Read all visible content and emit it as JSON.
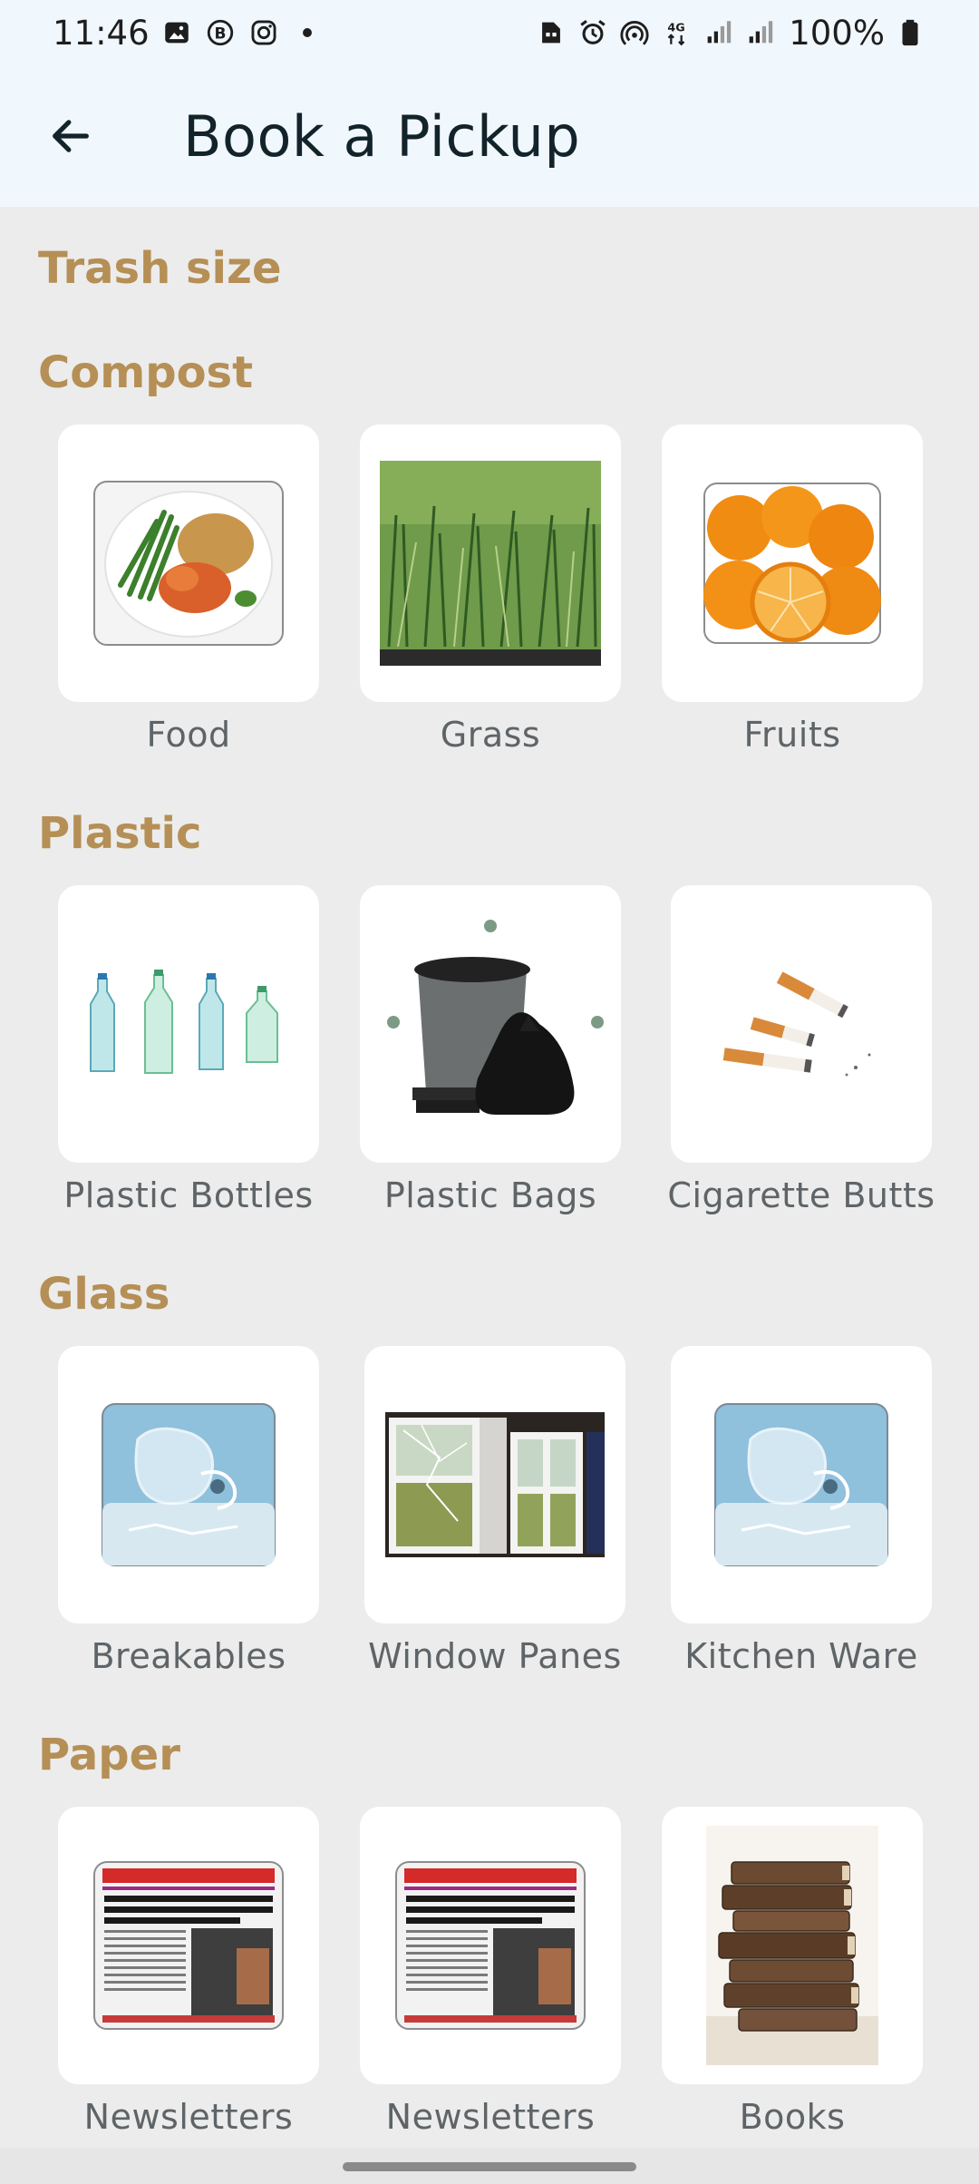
{
  "status_bar": {
    "time": "11:46",
    "battery": "100%",
    "icons_left": [
      "gallery-icon",
      "b-badge-icon",
      "instagram-icon",
      "dot-icon"
    ],
    "icons_right": [
      "sim-card-icon",
      "alarm-icon",
      "hotspot-icon",
      "4g-icon",
      "signal-icon",
      "signal-icon",
      "battery-icon"
    ]
  },
  "header": {
    "title": "Book a Pickup",
    "back_icon": "arrow-left-icon"
  },
  "trash_size_label": "Trash size",
  "sections": [
    {
      "title": "Compost",
      "items": [
        {
          "label": "Food"
        },
        {
          "label": "Grass"
        },
        {
          "label": "Fruits"
        }
      ]
    },
    {
      "title": "Plastic",
      "items": [
        {
          "label": "Plastic Bottles"
        },
        {
          "label": "Plastic Bags"
        },
        {
          "label": "Cigarette Butts"
        }
      ]
    },
    {
      "title": "Glass",
      "items": [
        {
          "label": "Breakables"
        },
        {
          "label": "Window Panes"
        },
        {
          "label": "Kitchen Ware"
        }
      ]
    },
    {
      "title": "Paper",
      "items": [
        {
          "label": "Newsletters"
        },
        {
          "label": "Newsletters"
        },
        {
          "label": "Books"
        }
      ]
    }
  ],
  "colors": {
    "accent": "#b58f55",
    "header_bg": "#f1f8fd",
    "page_bg": "#ececec",
    "label": "#5e6467"
  }
}
